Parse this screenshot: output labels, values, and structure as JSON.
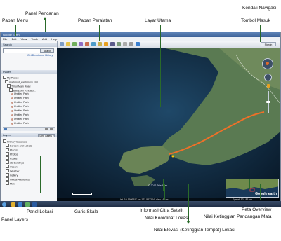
{
  "labels": {
    "panel_pencarian": "Panel Pencarian",
    "kendali_navigasi": "Kendali Navigasi",
    "papan_menu": "Papan Menu",
    "papan_peralatan": "Papan Peralatan",
    "layar_utama": "Layar Utama",
    "tombol_masuk": "Tombol Masuk",
    "panel_layers": "Panel Layers",
    "panel_lokasi": "Panel Lokasi",
    "garis_skala": "Garis Skala",
    "informasi_citra_satelit": "Informasi Citra Satelit",
    "nilai_koordinat_lokasi": "Nilai Koordinat Lokasi",
    "nilai_elevasi": "Nilai Elevasi (Ketinggian Tempat) Lokasi",
    "peta_overview": "Peta Overview",
    "nilai_ketinggian_mata": "Nilai Ketinggian Pandangan Mata"
  },
  "app": {
    "title": "Google Earth",
    "menu": [
      "File",
      "Edit",
      "View",
      "Tools",
      "Add",
      "Help"
    ],
    "sign_in": "Sign in",
    "search_header": "Search",
    "search_button": "Search",
    "search_links": [
      "Get Directions",
      "History"
    ],
    "places_header": "Places",
    "places": [
      "My Places",
      "mathmad_earthmose.kml",
      "Timur Main Road",
      "Batuputih Kinbaru...",
      "Untitled Path",
      "Untitled Path",
      "Untitled Path",
      "Untitled Path",
      "Untitled Path",
      "Untitled Path",
      "Untitled Path",
      "Untitled Path"
    ],
    "layers_header": "Layers",
    "layers_gallery": "Earth Gallery »",
    "layers": [
      "Primary Database",
      "Borders and Labels",
      "Places",
      "Photos",
      "Roads",
      "3D Buildings",
      "Ocean",
      "Weather",
      "Gallery",
      "Global Awareness",
      "More"
    ],
    "imagery_info": "© 2012 Tele Atlas",
    "status_bar": "lat -10.198651° lon 123.542244° elev 165 m",
    "eye_alt": "Eye alt 121.86 km",
    "overview_brand": "Google earth"
  },
  "colors": {
    "pointer_line": "#2a6a2a",
    "path_highlight": "#f07028",
    "water": "#0c2238",
    "land": "#5a7a52"
  },
  "icons": {
    "search": "search-icon",
    "nav_look": "look-joystick-icon",
    "nav_move": "move-joystick-icon",
    "zoom": "zoom-slider-icon",
    "pegman": "street-view-icon"
  }
}
